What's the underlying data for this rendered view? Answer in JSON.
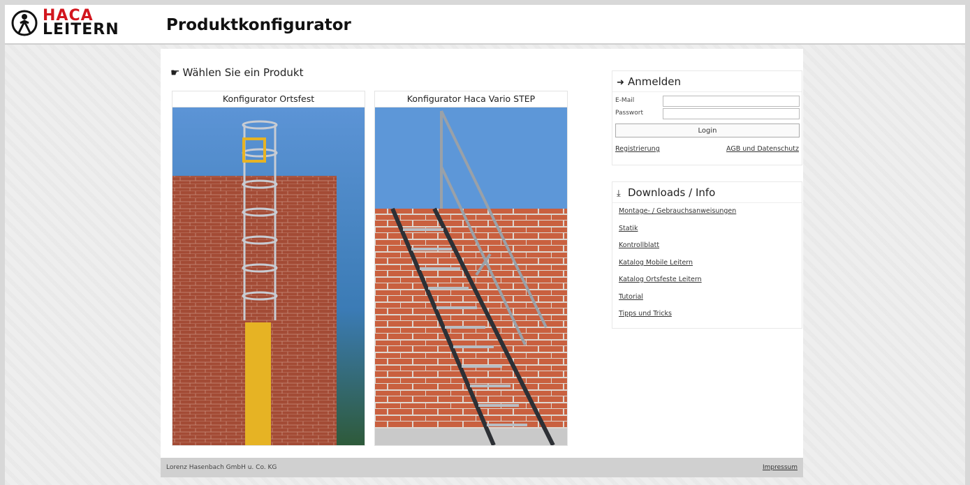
{
  "header": {
    "logo_line1": "HACA",
    "logo_line2": "LEITERN",
    "title": "Produktkonfigurator"
  },
  "main": {
    "choose_label": "Wählen Sie ein Produkt",
    "products": [
      {
        "title": "Konfigurator Ortsfest"
      },
      {
        "title": "Konfigurator Haca Vario STEP"
      }
    ]
  },
  "login": {
    "title": "Anmelden",
    "email_label": "E-Mail",
    "password_label": "Passwort",
    "button": "Login",
    "register_link": "Registrierung",
    "terms_link": "AGB und Datenschutz"
  },
  "downloads": {
    "title": "Downloads / Info",
    "links": [
      "Montage- / Gebrauchsanweisungen",
      "Statik",
      "Kontrollblatt",
      "Katalog Mobile Leitern",
      "Katalog Ortsfeste Leitern",
      "Tutorial",
      "Tipps und Tricks"
    ]
  },
  "footer": {
    "company": "Lorenz Hasenbach GmbH u. Co. KG",
    "imprint": "Impressum"
  },
  "colors": {
    "brand_red": "#d2161e",
    "sky": "#5d97d8",
    "brick": "#b5553c",
    "safety_yellow": "#e6b324"
  }
}
